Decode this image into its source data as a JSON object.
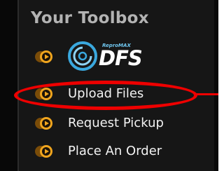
{
  "toolbox": {
    "title": "Your Toolbox"
  },
  "logo": {
    "brand_small": "ReproMAX",
    "brand_big": "DFS"
  },
  "menu": {
    "items": [
      {
        "label": "Upload Files",
        "icon": "circle-arrow-icon",
        "highlighted": true
      },
      {
        "label": "Request Pickup",
        "icon": "circle-arrow-icon",
        "highlighted": false
      },
      {
        "label": "Place An Order",
        "icon": "circle-arrow-icon",
        "highlighted": false
      }
    ]
  },
  "colors": {
    "background": "#161616",
    "title": "#b3b3b3",
    "icon_orange": "#e89a1c",
    "highlight_red": "#ee0000",
    "logo_blue": "#3aa8de"
  }
}
